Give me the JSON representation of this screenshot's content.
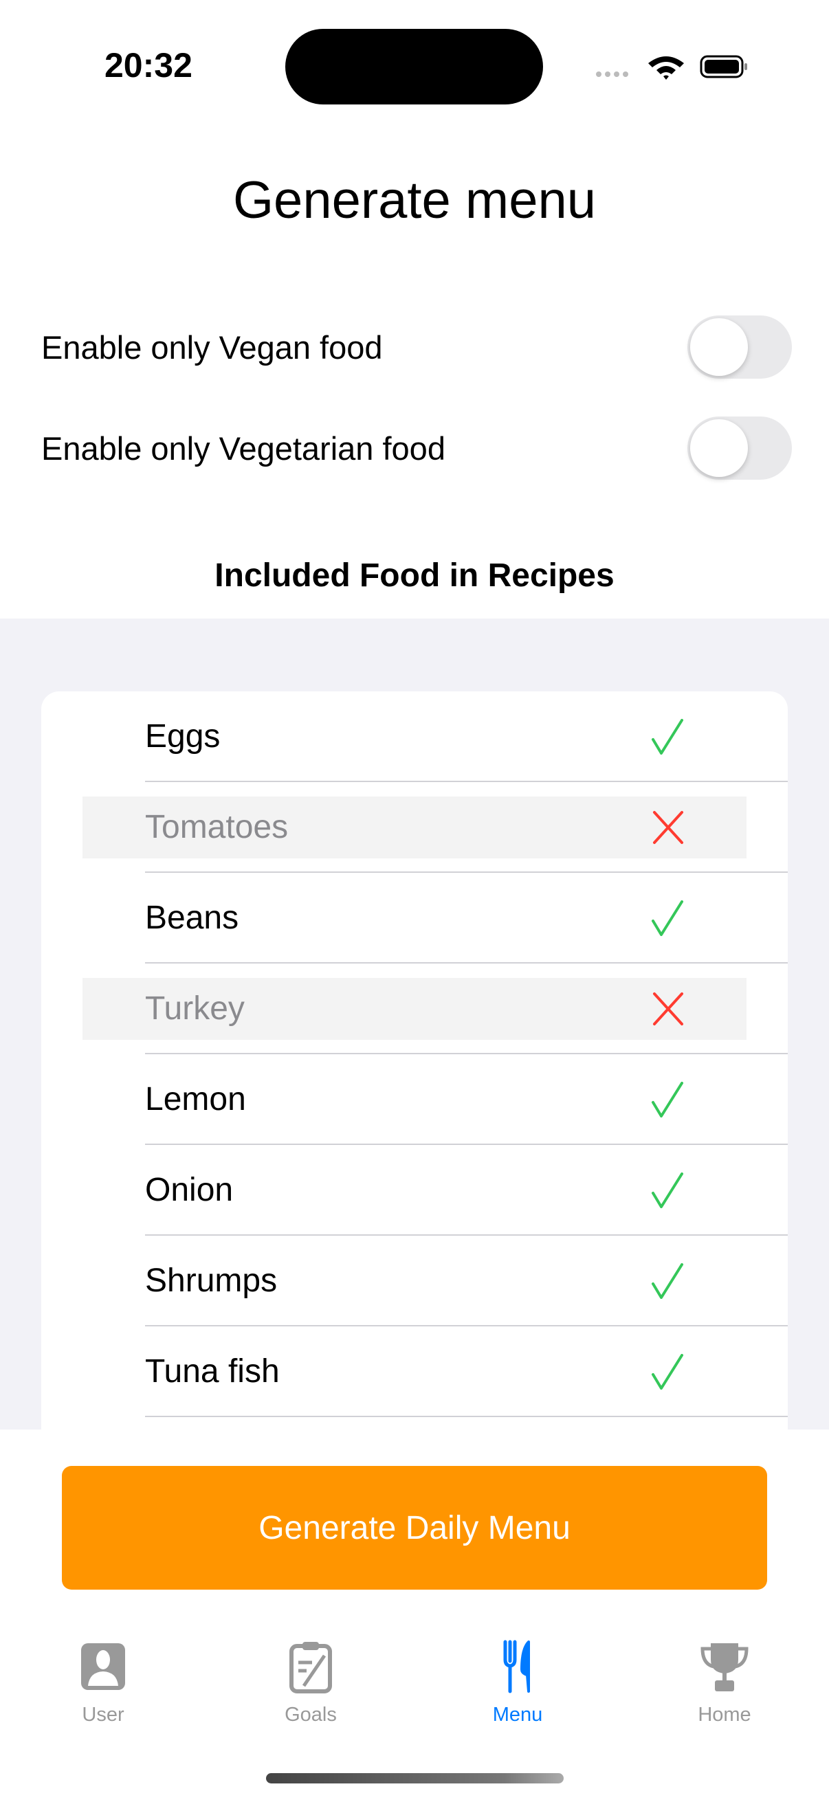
{
  "status_bar": {
    "time": "20:32"
  },
  "title": "Generate menu",
  "toggles": [
    {
      "label": "Enable only Vegan food",
      "on": false
    },
    {
      "label": "Enable only Vegetarian food",
      "on": false
    }
  ],
  "section_title": "Included Food in Recipes",
  "foods": [
    {
      "name": "Eggs",
      "included": true
    },
    {
      "name": "Tomatoes",
      "included": false
    },
    {
      "name": "Beans",
      "included": true
    },
    {
      "name": "Turkey",
      "included": false
    },
    {
      "name": "Lemon",
      "included": true
    },
    {
      "name": "Onion",
      "included": true
    },
    {
      "name": "Shrumps",
      "included": true
    },
    {
      "name": "Tuna fish",
      "included": true
    }
  ],
  "generate_button": "Generate Daily Menu",
  "colors": {
    "accent": "#007aff",
    "button": "#ff9500",
    "check": "#34c759",
    "cross": "#ff3b30"
  },
  "tabs": [
    {
      "label": "User",
      "icon": "person-icon"
    },
    {
      "label": "Goals",
      "icon": "clipboard-icon"
    },
    {
      "label": "Menu",
      "icon": "fork-knife-icon",
      "active": true
    },
    {
      "label": "Home",
      "icon": "trophy-icon"
    }
  ]
}
